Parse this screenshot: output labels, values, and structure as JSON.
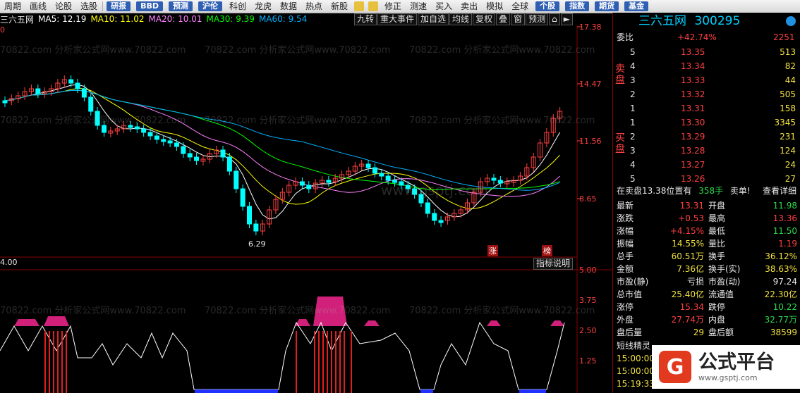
{
  "toolbar": {
    "items": [
      "周期",
      "画线",
      "论股",
      "选股"
    ],
    "badges": [
      "研报",
      "BBD",
      "预测",
      "沪伦"
    ],
    "items2": [
      "科创",
      "龙虎",
      "数据",
      "热点",
      "新股"
    ],
    "items3": [
      "修正",
      "测速",
      "买入",
      "卖出",
      "模拟",
      "全球"
    ],
    "badges2": [
      "个股",
      "指数",
      "期货",
      "基金"
    ]
  },
  "chart": {
    "stock_name": "三六五网",
    "ma5": "MA5: 12.19",
    "ma10": "MA10: 11.02",
    "ma20": "MA20: 10.01",
    "ma30": "MA30: 9.39",
    "ma60": "MA60: 9.54",
    "buttons": [
      "九转",
      "重大事件",
      "加自选",
      "均线",
      "复权",
      "叠",
      "窗",
      "预测"
    ],
    "left_label": "0",
    "price_axis": [
      "17.38",
      "14.47",
      "11.56",
      "8.65"
    ],
    "min_label": "6.29",
    "tags": [
      "涨",
      "榜"
    ],
    "colors": {
      "ma5": "#ffffff",
      "ma10": "#ffff00",
      "ma20": "#ff80ff",
      "ma30": "#00ff00",
      "ma60": "#00b0ff",
      "up": "#ff4040",
      "down": "#00ffff"
    }
  },
  "indicator": {
    "left_label": "4.00",
    "help_button": "指标说明",
    "axis": [
      "5.00",
      "3.75",
      "2.50",
      "1.25"
    ]
  },
  "watermark": "70822.com 分析家公式网www.70822.com",
  "watermark2": "www.gsptj.com",
  "quote": {
    "title_name": "三六五网",
    "title_code": "300295",
    "weibi_label": "委比",
    "weibi_value": "+42.74%",
    "weibi_diff": "2251",
    "sell_label": "卖盘",
    "buy_label": "买盘",
    "sells": [
      {
        "level": "5",
        "price": "13.35",
        "vol": "513"
      },
      {
        "level": "4",
        "price": "13.34",
        "vol": "82"
      },
      {
        "level": "3",
        "price": "13.33",
        "vol": "44"
      },
      {
        "level": "2",
        "price": "13.32",
        "vol": "505"
      },
      {
        "level": "1",
        "price": "13.31",
        "vol": "158"
      }
    ],
    "buys": [
      {
        "level": "1",
        "price": "13.30",
        "vol": "3345"
      },
      {
        "level": "2",
        "price": "13.29",
        "vol": "231"
      },
      {
        "level": "3",
        "price": "13.28",
        "vol": "124"
      },
      {
        "level": "4",
        "price": "13.27",
        "vol": "24"
      },
      {
        "level": "5",
        "price": "13.26",
        "vol": "27"
      }
    ],
    "notice_prefix": "在卖盘13.38位置有",
    "notice_vol": "358手",
    "notice_sell": "卖单!",
    "notice_link": "查看详细",
    "stats": [
      {
        "l1": "最新",
        "v1": "13.31",
        "c1": "red",
        "l2": "开盘",
        "v2": "11.98",
        "c2": "green"
      },
      {
        "l1": "涨跌",
        "v1": "+0.53",
        "c1": "red",
        "l2": "最高",
        "v2": "13.36",
        "c2": "red"
      },
      {
        "l1": "涨幅",
        "v1": "+4.15%",
        "c1": "red",
        "l2": "最低",
        "v2": "11.50",
        "c2": "green"
      },
      {
        "l1": "振幅",
        "v1": "14.55%",
        "c1": "yel",
        "l2": "量比",
        "v2": "1.19",
        "c2": "red"
      },
      {
        "l1": "总手",
        "v1": "60.51万",
        "c1": "yel",
        "l2": "换手",
        "v2": "36.12%",
        "c2": "yel"
      },
      {
        "l1": "金额",
        "v1": "7.36亿",
        "c1": "yel",
        "l2": "换手(实)",
        "v2": "38.63%",
        "c2": "yel"
      },
      {
        "l1": "市盈(静)",
        "v1": "亏损",
        "c1": "wht",
        "l2": "市盈(动)",
        "v2": "97.24",
        "c2": "wht"
      },
      {
        "l1": "总市值",
        "v1": "25.40亿",
        "c1": "yel",
        "l2": "流通值",
        "v2": "22.30亿",
        "c2": "yel"
      },
      {
        "l1": "涨停",
        "v1": "15.34",
        "c1": "red",
        "l2": "跌停",
        "v2": "10.22",
        "c2": "green"
      },
      {
        "l1": "外盘",
        "v1": "27.74万",
        "c1": "red",
        "l2": "内盘",
        "v2": "32.77万",
        "c2": "green"
      },
      {
        "l1": "盘后量",
        "v1": "29",
        "c1": "yel",
        "l2": "盘后额",
        "v2": "38599",
        "c2": "yel"
      }
    ],
    "short_title": "短线精灵",
    "short_times": [
      "15:00:00",
      "15:00:00",
      "15:19:33"
    ],
    "logo_mark": "G",
    "logo_text": "公式平台",
    "logo_url": "www.gsptj.com"
  }
}
